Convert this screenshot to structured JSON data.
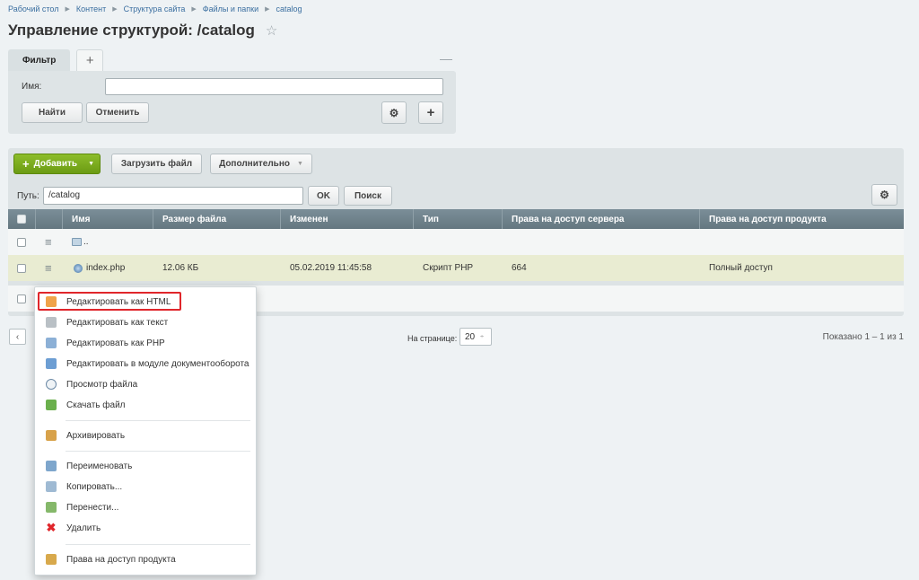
{
  "breadcrumb": [
    "Рабочий стол",
    "Контент",
    "Структура сайта",
    "Файлы и папки",
    "catalog"
  ],
  "page": {
    "title": "Управление структурой: /catalog"
  },
  "filter": {
    "tab_label": "Фильтр",
    "field_label": "Имя:",
    "field_value": "",
    "find_label": "Найти",
    "cancel_label": "Отменить"
  },
  "toolbar": {
    "add_label": "Добавить",
    "upload_label": "Загрузить файл",
    "more_label": "Дополнительно"
  },
  "path": {
    "label": "Путь:",
    "value": "/catalog",
    "ok_label": "OK",
    "search_label": "Поиск"
  },
  "table": {
    "columns": [
      "Имя",
      "Размер файла",
      "Изменен",
      "Тип",
      "Права на доступ сервера",
      "Права на доступ продукта"
    ],
    "up_row": {
      "name": ".."
    },
    "rows": [
      {
        "name": "index.php",
        "size": "12.06 КБ",
        "modified": "05.02.2019 11:45:58",
        "type": "Скрипт PHP",
        "server_rights": "664",
        "product_rights": "Полный доступ"
      }
    ]
  },
  "pager": {
    "per_page_label": "На странице:",
    "per_page_value": "20",
    "shown": "Показано 1 – 1 из 1"
  },
  "context_menu": {
    "items": [
      {
        "label": "Редактировать как HTML",
        "icon": "edit-html-icon"
      },
      {
        "label": "Редактировать как текст",
        "icon": "edit-text-icon"
      },
      {
        "label": "Редактировать как PHP",
        "icon": "edit-php-icon"
      },
      {
        "label": "Редактировать в модуле документооборота",
        "icon": "workflow-icon"
      },
      {
        "label": "Просмотр файла",
        "icon": "view-icon"
      },
      {
        "label": "Скачать файл",
        "icon": "download-icon"
      },
      {
        "label": "Архивировать",
        "icon": "archive-icon"
      },
      {
        "label": "Переименовать",
        "icon": "rename-icon"
      },
      {
        "label": "Копировать...",
        "icon": "copy-icon"
      },
      {
        "label": "Перенести...",
        "icon": "move-icon"
      },
      {
        "label": "Удалить",
        "icon": "delete-icon"
      },
      {
        "label": "Права на доступ продукта",
        "icon": "rights-icon"
      }
    ]
  },
  "colors": {
    "accent_green": "#77a81a",
    "header_gray": "#6f818a",
    "highlight_red": "#e0262b",
    "link_blue": "#3b6fa0"
  }
}
